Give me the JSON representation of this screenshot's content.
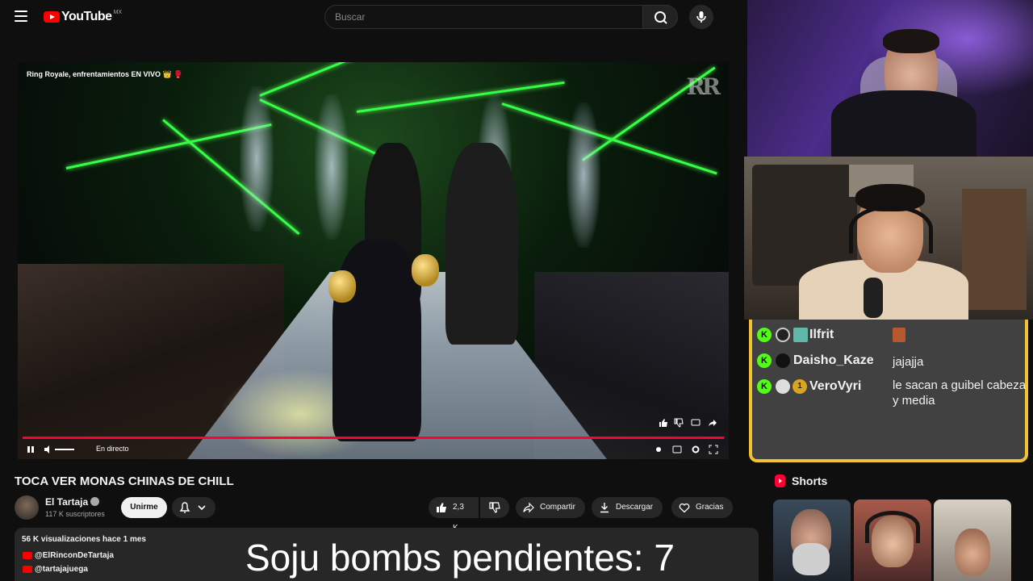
{
  "header": {
    "logo_text": "YouTube",
    "country_code": "MX",
    "search_placeholder": "Buscar"
  },
  "player": {
    "overlay_title": "Ring Royale, enfrentamientos EN VIVO 👑 🥊",
    "live_label": "En directo",
    "channel_watermark": "RR",
    "progress_fraction": 1.0
  },
  "video": {
    "title": "TOCA VER MONAS CHINAS DE CHILL",
    "channel_name": "El Tartaja",
    "subscribers": "117 K suscriptores",
    "join_label": "Unirme",
    "likes": "2,3 K",
    "share_label": "Compartir",
    "download_label": "Descargar",
    "thanks_label": "Gracias"
  },
  "description": {
    "meta": "56 K visualizaciones  hace 1 mes",
    "links": [
      "@ElRinconDeTartaja",
      "@tartajajuega"
    ]
  },
  "overlay": {
    "soju_text": "Soju bombs pendientes: 7"
  },
  "chat": {
    "accent_color": "#f2c230",
    "messages": [
      {
        "user": "Ilfrit",
        "message": ""
      },
      {
        "user": "Daisho_Kaze",
        "message": "jajajja"
      },
      {
        "user": "VeroVyri",
        "message": "le sacan a guibel cabeza y media"
      }
    ]
  },
  "shorts": {
    "heading": "Shorts"
  },
  "colors": {
    "brand_red": "#ff0000",
    "kick_green": "#53fc18",
    "progress_red": "#ff0033"
  }
}
